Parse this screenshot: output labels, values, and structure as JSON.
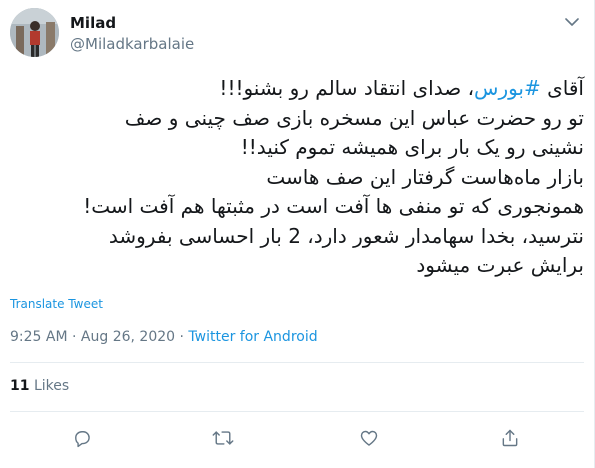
{
  "user": {
    "display_name": "Milad",
    "handle": "@Miladkarbalaie"
  },
  "tweet": {
    "line1_prefix": "آقای ",
    "hashtag": "#بورس",
    "line1_suffix": "، صدای انتقاد سالم رو بشنو!!!",
    "lines": [
      "تو رو حضرت عباس این مسخره بازی صف چینی و صف",
      "نشینی رو یک بار برای همیشه تموم کنید!!",
      "بازار ماه‌هاست گرفتار این صف هاست",
      "همونجوری که تو منفی ها آفت است در مثبتها هم آفت است!",
      "نترسید، بخدا سهامدار شعور دارد، 2 بار احساسی بفروشد",
      "برایش عبرت میشود"
    ]
  },
  "translate_label": "Translate Tweet",
  "meta": {
    "time": "9:25 AM",
    "separator": " · ",
    "date": "Aug 26, 2020",
    "source": "Twitter for Android"
  },
  "stats": {
    "likes_count": "11",
    "likes_label": "Likes"
  },
  "colors": {
    "accent": "#1b95e0",
    "text": "#14171a",
    "secondary": "#657786",
    "divider": "#e6ecf0"
  },
  "icons": {
    "caret": "chevron-down-icon",
    "reply": "reply-icon",
    "retweet": "retweet-icon",
    "like": "heart-icon",
    "share": "share-icon"
  }
}
